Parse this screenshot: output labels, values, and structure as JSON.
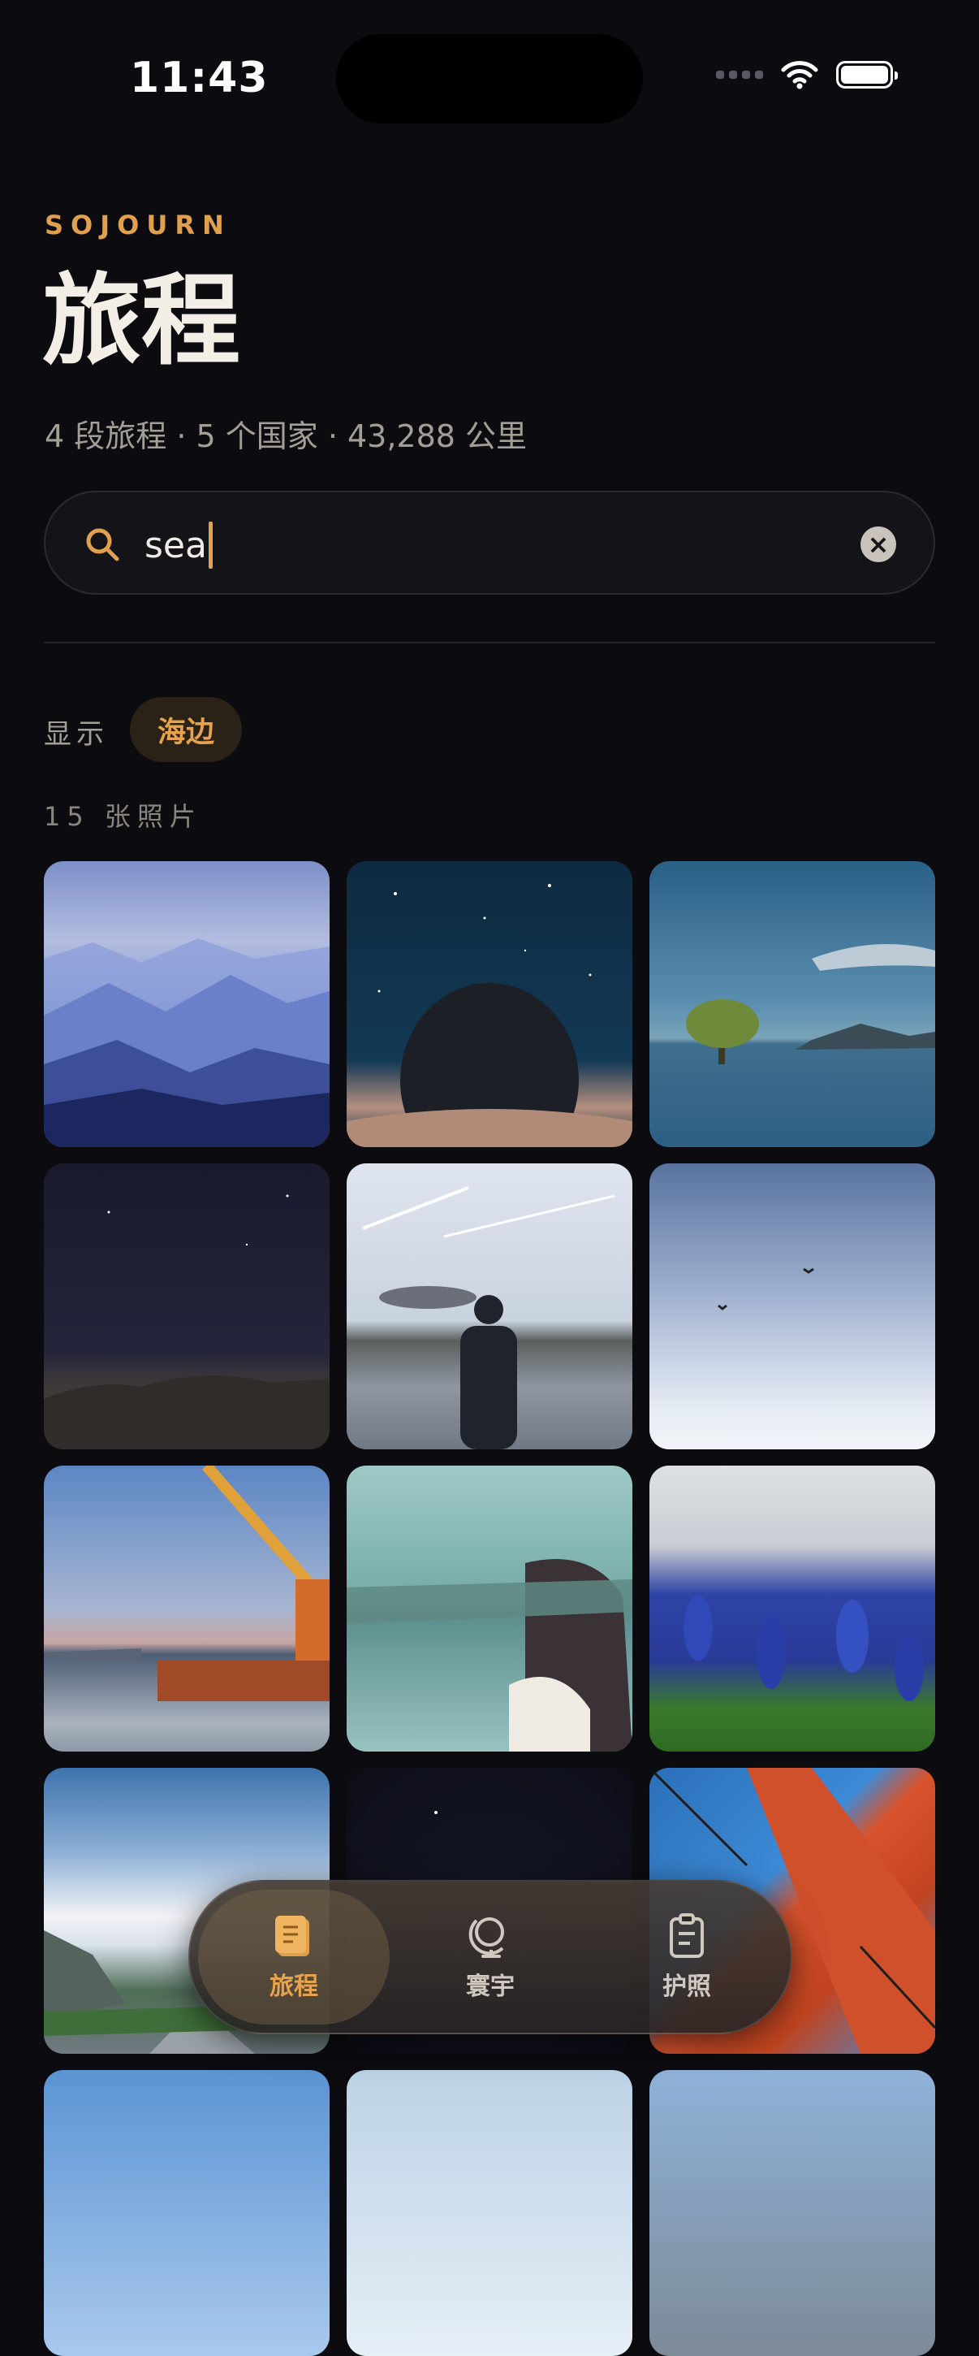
{
  "status": {
    "time": "11:43"
  },
  "header": {
    "brand": "SOJOURN",
    "title": "旅程",
    "subtitle": "4 段旅程 · 5 个国家 · 43,288 公里"
  },
  "search": {
    "value": "sea",
    "icons": [
      "search-icon",
      "clear-icon"
    ]
  },
  "filter": {
    "label": "显示",
    "chip": "海边"
  },
  "results": {
    "count_label": "15 张照片"
  },
  "photos": [
    "misty-blue-mountains",
    "person-under-starry-sky",
    "lone-tree-in-lake",
    "starry-night-over-hills",
    "man-standing-by-lake",
    "birds-in-pale-sky",
    "crane-boat-in-harbor",
    "woman-with-blindfold",
    "bluebonnet-flowers",
    "mountain-road-clouds",
    "dark-night-sky",
    "red-bridge-tower",
    "clouds-blue-sky",
    "pale-sky",
    "rocky-cliff"
  ],
  "tabs": [
    {
      "label": "旅程",
      "icon": "journal-icon",
      "active": true
    },
    {
      "label": "寰宇",
      "icon": "globe-icon",
      "active": false
    },
    {
      "label": "护照",
      "icon": "passport-icon",
      "active": false
    }
  ],
  "colors": {
    "accent": "#e0a04d",
    "background": "#0c0b10"
  }
}
